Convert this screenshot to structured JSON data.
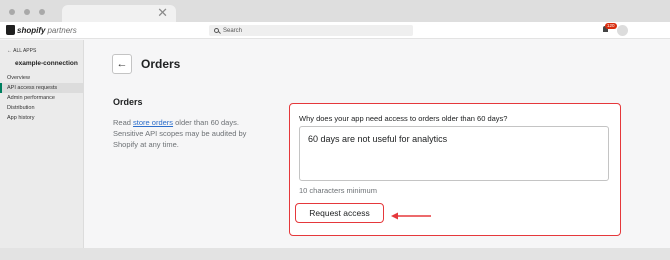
{
  "browser": {
    "tab_close": "✕"
  },
  "topbar": {
    "logo_text": "shopify",
    "logo_sub": "partners",
    "search_placeholder": "Search",
    "notification_count": "120"
  },
  "sidebar": {
    "back_label": "← ALL APPS",
    "app_name": "example-connection",
    "items": [
      {
        "label": "Overview",
        "active": false
      },
      {
        "label": "API access requests",
        "active": true
      },
      {
        "label": "Admin performance",
        "active": false
      },
      {
        "label": "Distribution",
        "active": false
      },
      {
        "label": "App history",
        "active": false
      }
    ]
  },
  "page": {
    "back_icon": "←",
    "title": "Orders",
    "section_title": "Orders",
    "desc_prefix": "Read ",
    "desc_link": "store orders",
    "desc_suffix": " older than 60 days. Sensitive API scopes may be audited by Shopify at any time."
  },
  "form": {
    "question": "Why does your app need access to orders older than 60 days?",
    "answer": "60 days are not useful for analytics",
    "help_text": "10 characters minimum",
    "submit_label": "Request access"
  },
  "colors": {
    "highlight": "#e5383b",
    "link": "#2c6ecb",
    "active_nav": "#008060"
  }
}
